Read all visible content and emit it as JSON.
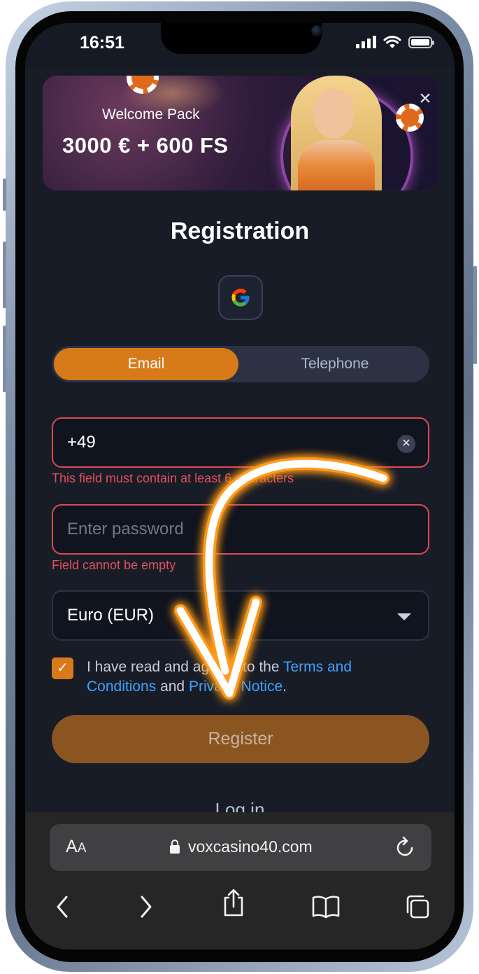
{
  "status_bar": {
    "time": "16:51",
    "icons": [
      "signal-icon",
      "wifi-icon",
      "battery-icon"
    ]
  },
  "banner": {
    "headline": "Welcome Pack",
    "offer": "3000 € + 600 FS",
    "close_icon": "close-icon"
  },
  "page_title": "Registration",
  "social_login": {
    "provider_icon": "google-icon"
  },
  "tabs": [
    {
      "label": "Email",
      "active": true
    },
    {
      "label": "Telephone",
      "active": false
    }
  ],
  "form": {
    "contact_field": {
      "value": "+49",
      "error": "This field must contain at least 6 characters"
    },
    "password_field": {
      "placeholder": "Enter password",
      "error": "Field cannot be empty"
    },
    "currency_select": {
      "value": "Euro (EUR)"
    },
    "terms": {
      "checked": true,
      "text_before": "I have read and agreed to the ",
      "terms_link": "Terms and Conditions",
      "text_middle": " and ",
      "privacy_link": "Privacy Notice",
      "text_after": "."
    },
    "register_label": "Register"
  },
  "login_link": "Log in",
  "browser": {
    "text_size_label_big": "A",
    "text_size_label_small": "A",
    "url": "voxcasino40.com",
    "nav_icons": [
      "back-icon",
      "forward-icon",
      "share-icon",
      "bookmarks-icon",
      "tabs-icon"
    ]
  },
  "colors": {
    "accent": "#d97a1a",
    "error": "#e0505d",
    "link": "#3fa3ff",
    "background": "#181c27",
    "overlay_arrow": "#ffffff",
    "overlay_glow": "#ff9a1f"
  }
}
